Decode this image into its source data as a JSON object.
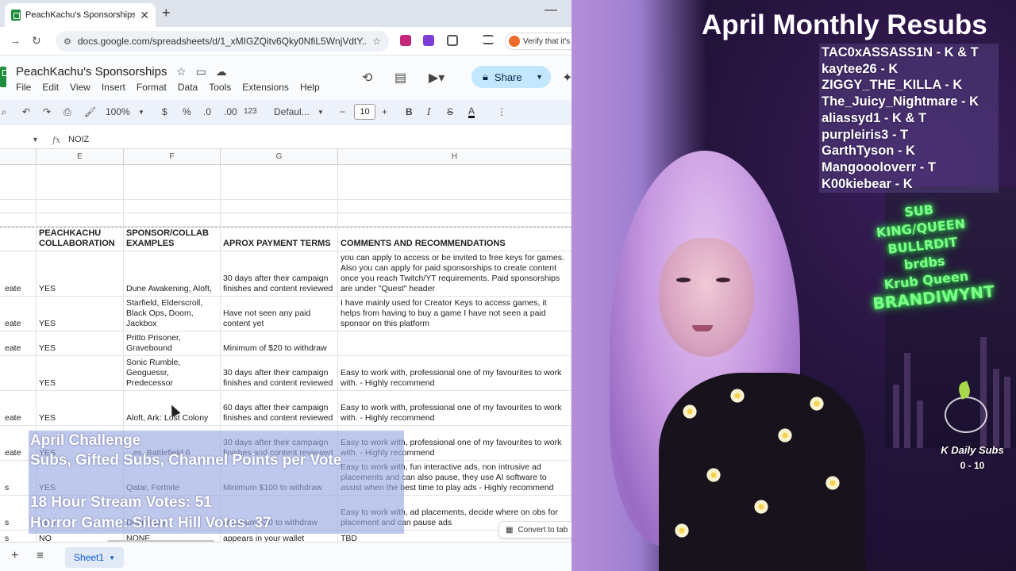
{
  "browser": {
    "tab_title": "PeachKachu's Sponsorships - G",
    "url": "docs.google.com/spreadsheets/d/1_xMIGZQitv6Qky0NfiL5WnjVdtY...",
    "verify_label": "Verify that it's"
  },
  "sheets": {
    "doc_title": "PeachKachu's Sponsorships",
    "menus": [
      "File",
      "Edit",
      "View",
      "Insert",
      "Format",
      "Data",
      "Tools",
      "Extensions",
      "Help"
    ],
    "share_label": "Share",
    "zoom": "100%",
    "currency": "$",
    "percent": "%",
    "decimals": ".0",
    "more_decimals": ".00",
    "number_format": "123",
    "font": "Defaul...",
    "font_size": "10",
    "formula_value": "NOIZ",
    "columns": [
      "E",
      "F",
      "G",
      "H"
    ],
    "header_row": {
      "e": "PEACHKACHU COLLABORATION",
      "f": "SPONSOR/COLLAB EXAMPLES",
      "g": "APROX PAYMENT TERMS",
      "h": "COMMENTS AND RECOMMENDATIONS"
    },
    "rows": [
      {
        "cut": "eate",
        "e": "YES",
        "f": "Dune Awakening, Aloft,",
        "g": "30 days after their campaign finishes and content reviewed",
        "h": "you can apply to access or be invited to free keys for games. Also you can apply for paid sponsorships to create content once you reach Twitch/YT requirements. Paid sponsorships are under \"Quest\" header"
      },
      {
        "cut": "eate",
        "e": "YES",
        "f": "Starfield, Elderscroll, Black Ops, Doom, Jackbox",
        "g": "Have not seen any paid content yet",
        "h": "I have mainly used for Creator Keys to access games, it helps from having to buy a game I have not seen a paid sponsor on this platform"
      },
      {
        "cut": "eate",
        "e": "YES",
        "f": "Pritto Prisoner, Gravebound",
        "g": "Minimum of $20 to withdraw",
        "h": ""
      },
      {
        "cut": "",
        "e": "YES",
        "f": "Sonic Rumble, Geoguessr, Predecessor",
        "g": "30 days after their campaign finishes and content reviewed",
        "h": "Easy to work with, professional one of my favourites to work with. - Highly recommend"
      },
      {
        "cut": "eate",
        "e": "YES",
        "f": "Aloft, Ark: Lost Colony",
        "g": "60 days after their campaign finishes and content reviewed",
        "h": "Easy to work with, professional one of my favourites to work with. - Highly recommend"
      },
      {
        "cut": "eate",
        "e": "YES",
        "f": "...es, Battlefield 6",
        "g": "30 days after their campaign finishes and content reviewed",
        "h": "Easy to work with, professional one of my favourites to work with. - Highly recommend"
      },
      {
        "cut": "s",
        "e": "YES",
        "f": "Qatar, Fortnite",
        "g": "Minimum $100 to withdraw",
        "h": "Easy to work with, fun interactive ads, non intrusive ad placements and can also pause, they use AI software to assist when the best time to play ads - Highly recommend"
      },
      {
        "cut": "s",
        "e": "YES",
        "f": "Doomsday",
        "g": "Minimum $20 to withdraw",
        "h": "Easy to work with, ad placements, decide where on obs for placement and can pause ads"
      },
      {
        "cut": "s",
        "e": "NO",
        "f": "NONE",
        "g": "appears in your wallet",
        "h": "TBD"
      }
    ],
    "sheet_tab": "Sheet1",
    "convert_label": "Convert to tab"
  },
  "challenge": {
    "title": "April Challenge",
    "subtitle": "Subs, Gifted Subs, Channel Points per Vote",
    "vote1": "18 Hour Stream Votes: 51",
    "vote2": "Horror Game: Silent Hill Votes: 37"
  },
  "resubs": {
    "title": "April Monthly Resubs",
    "names": [
      "TAC0xASSASS1N - K & T",
      "kaytee26 - K",
      "ZIGGY_THE_KILLA - K",
      "The_Juicy_Nightmare  - K",
      "aliassyd1 -  K & T",
      "purpleiris3  - T",
      "GarthTyson - K",
      "Mangoooloverr - T",
      "K00kiebear - K"
    ]
  },
  "neon_sign": {
    "line1": "SUB KING/QUEEN",
    "line2": "BULLRDIT",
    "line3": "brdbs",
    "line4": "Krub Queen",
    "line5": "BRANDIWYNT"
  },
  "daily_subs": {
    "label": "K Daily Subs",
    "count": "0 - 10"
  },
  "colors": {
    "share": "#c2e7ff",
    "sheets_green": "#1e8e3e",
    "neon": "#7dff8a",
    "challenge_overlay": "#96a5e1"
  }
}
